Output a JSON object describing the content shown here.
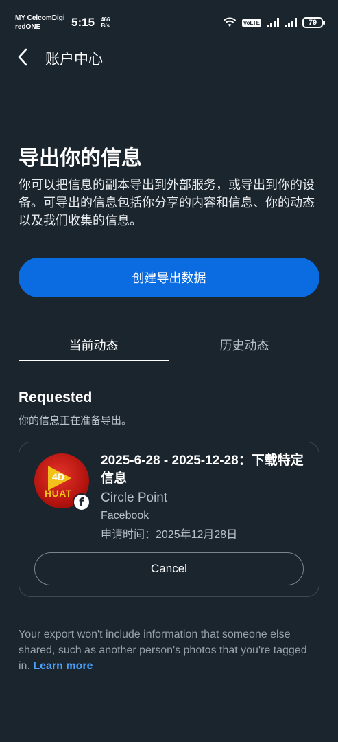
{
  "status_bar": {
    "carrier_line1": "MY CelcomDigi",
    "carrier_line2": "redONE",
    "time": "5:15",
    "net_speed_value": "466",
    "net_speed_unit": "B/s",
    "volte": "VoLTE",
    "battery": "79"
  },
  "header": {
    "title": "账户中心",
    "back_icon": "chevron-left-icon"
  },
  "main": {
    "title": "导出你的信息",
    "description": "你可以把信息的副本导出到外部服务，或导出到你的设备。可导出的信息包括你分享的内容和信息、你的动态以及我们收集的信息。",
    "create_button": "创建导出数据"
  },
  "tabs": [
    {
      "label": "当前动态",
      "active": true
    },
    {
      "label": "历史动态",
      "active": false
    }
  ],
  "requested": {
    "title": "Requested",
    "subtitle": "你的信息正在准备导出。"
  },
  "export_card": {
    "icon_text_top": "4D",
    "icon_text_bottom": "HUAT",
    "badge_icon": "facebook-icon",
    "title": "2025-6-28 - 2025-12-28：下载特定信息",
    "app_name": "Circle Point",
    "source": "Facebook",
    "request_date": "申请时间：2025年12月28日",
    "cancel_button": "Cancel"
  },
  "footer": {
    "text": "Your export won't include information that someone else shared, such as another person's photos that you're tagged in.",
    "link": "Learn more"
  },
  "colors": {
    "background": "#1b252e",
    "primary_button": "#0a6ce0",
    "link": "#4aa2ff"
  }
}
